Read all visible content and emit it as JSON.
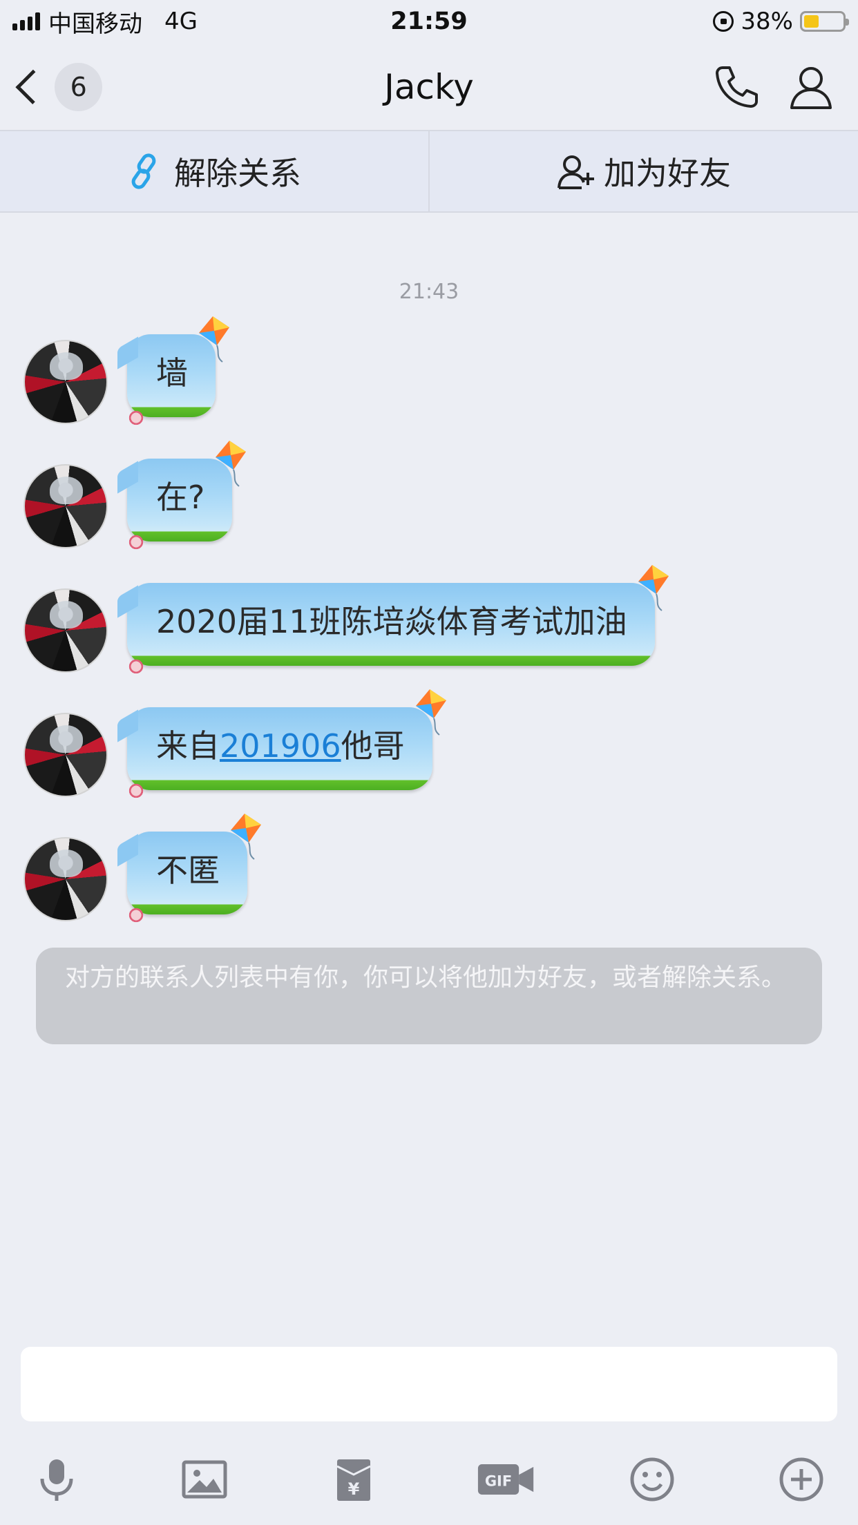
{
  "status_bar": {
    "carrier": "中国移动",
    "network": "4G",
    "time": "21:59",
    "battery_percent_label": "38%",
    "battery_level": 0.38
  },
  "nav": {
    "back_count": "6",
    "title": "Jacky",
    "call_icon": "phone-icon",
    "profile_icon": "person-icon"
  },
  "actions": {
    "unlink_label": "解除关系",
    "add_friend_label": "加为好友"
  },
  "chat": {
    "timestamp": "21:43",
    "messages": [
      {
        "text": "墙"
      },
      {
        "text": "在?"
      },
      {
        "text": "2020届11班陈培焱体育考试加油"
      },
      {
        "prefix": "来自",
        "link": "201906",
        "suffix": "他哥"
      },
      {
        "text": "不匿"
      }
    ],
    "notice": "对方的联系人列表中有你，你可以将他加为好友，或者解除关系。"
  },
  "input": {
    "value": ""
  },
  "toolbar": {
    "icons": [
      "microphone-icon",
      "image-icon",
      "red-packet-icon",
      "gif-icon",
      "emoji-icon",
      "plus-icon"
    ]
  },
  "colors": {
    "background": "#eceef4",
    "bubble_blue": "#a9d9f7",
    "bubble_green": "#4caf22",
    "link": "#1a7fd6",
    "notice_bg": "#c8cacf"
  }
}
